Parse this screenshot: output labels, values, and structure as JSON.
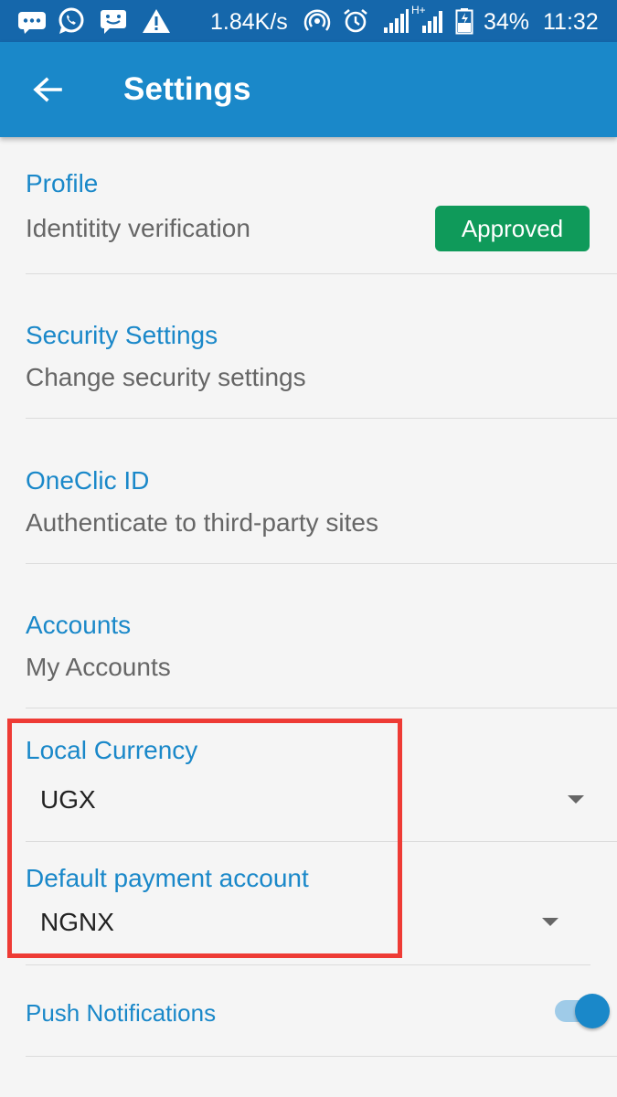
{
  "status_bar": {
    "network_speed": "1.84K/s",
    "network_type": "H+",
    "battery": "34%",
    "time": "11:32",
    "icons": [
      "chat-bubble-icon",
      "whatsapp-icon",
      "message-icon",
      "warning-icon",
      "hotspot-icon",
      "alarm-icon",
      "signal-icon",
      "signal-icon",
      "battery-icon"
    ]
  },
  "app_bar": {
    "title": "Settings",
    "back_icon": "arrow-left-icon"
  },
  "settings": {
    "profile": {
      "title": "Profile",
      "subtitle": "Identitity verification",
      "badge": "Approved"
    },
    "security": {
      "title": "Security Settings",
      "subtitle": "Change security settings"
    },
    "oneclic": {
      "title": "OneClic ID",
      "subtitle": "Authenticate to third-party sites"
    },
    "accounts": {
      "title": "Accounts",
      "subtitle": "My Accounts"
    },
    "local_currency": {
      "title": "Local Currency",
      "value": "UGX"
    },
    "default_payment": {
      "title": "Default payment account",
      "value": "NGNX"
    },
    "push_notifications": {
      "title": "Push Notifications",
      "enabled": true
    }
  },
  "colors": {
    "status_bar": "#1567ab",
    "app_bar": "#1a88c9",
    "accent": "#1a88c9",
    "badge": "#0f9a5a",
    "highlight": "#ee3b35"
  }
}
